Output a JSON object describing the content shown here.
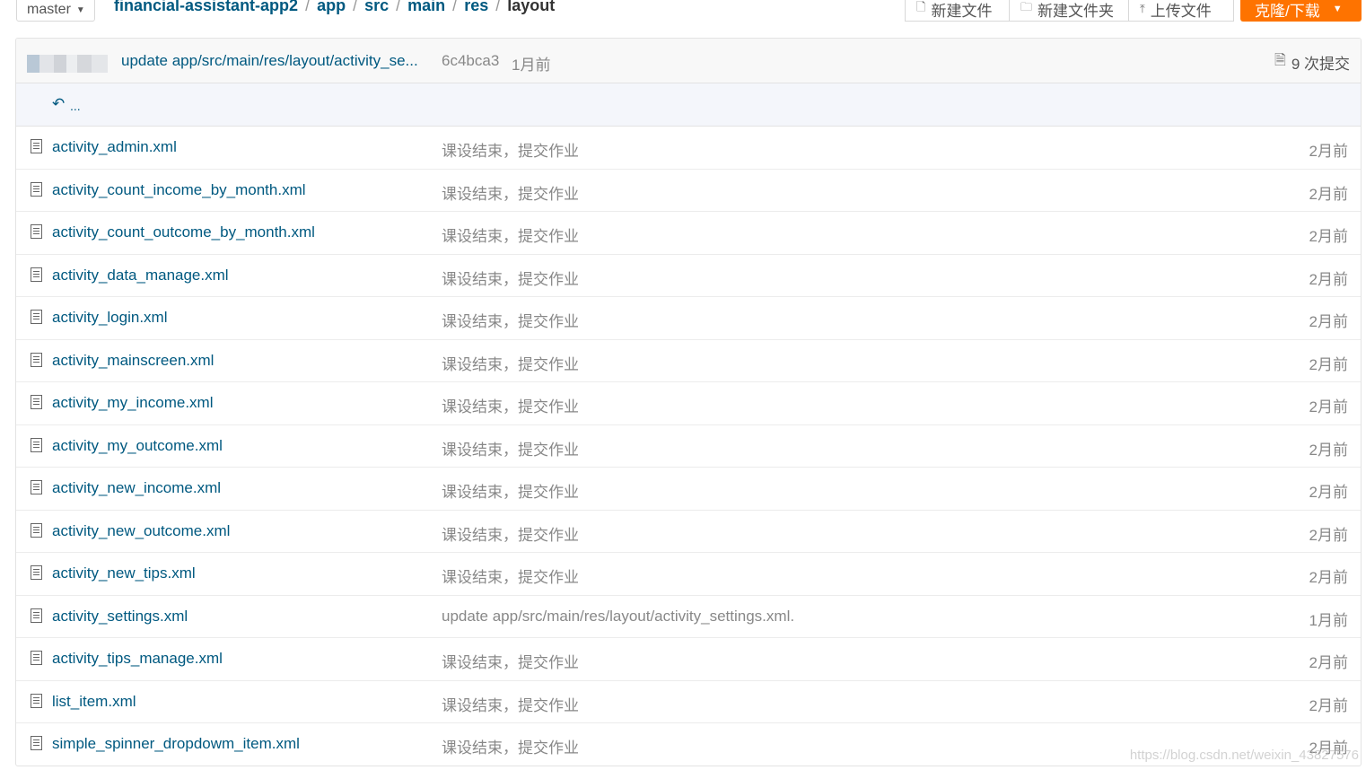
{
  "branch": "master",
  "breadcrumb": [
    "financial-assistant-app2",
    "app",
    "src",
    "main",
    "res"
  ],
  "breadcrumb_current": "layout",
  "actions": {
    "new_file": "新建文件",
    "new_folder": "新建文件夹",
    "upload": "上传文件",
    "clone": "克隆/下载"
  },
  "latest_commit": {
    "message": "update app/src/main/res/layout/activity_se...",
    "hash": "6c4bca3",
    "time": "1月前",
    "count": "9 次提交"
  },
  "parent_dir": "...",
  "files": [
    {
      "name": "activity_admin.xml",
      "message": "课设结束，提交作业",
      "time": "2月前"
    },
    {
      "name": "activity_count_income_by_month.xml",
      "message": "课设结束，提交作业",
      "time": "2月前"
    },
    {
      "name": "activity_count_outcome_by_month.xml",
      "message": "课设结束，提交作业",
      "time": "2月前"
    },
    {
      "name": "activity_data_manage.xml",
      "message": "课设结束，提交作业",
      "time": "2月前"
    },
    {
      "name": "activity_login.xml",
      "message": "课设结束，提交作业",
      "time": "2月前"
    },
    {
      "name": "activity_mainscreen.xml",
      "message": "课设结束，提交作业",
      "time": "2月前"
    },
    {
      "name": "activity_my_income.xml",
      "message": "课设结束，提交作业",
      "time": "2月前"
    },
    {
      "name": "activity_my_outcome.xml",
      "message": "课设结束，提交作业",
      "time": "2月前"
    },
    {
      "name": "activity_new_income.xml",
      "message": "课设结束，提交作业",
      "time": "2月前"
    },
    {
      "name": "activity_new_outcome.xml",
      "message": "课设结束，提交作业",
      "time": "2月前"
    },
    {
      "name": "activity_new_tips.xml",
      "message": "课设结束，提交作业",
      "time": "2月前"
    },
    {
      "name": "activity_settings.xml",
      "message": "update app/src/main/res/layout/activity_settings.xml.",
      "time": "1月前"
    },
    {
      "name": "activity_tips_manage.xml",
      "message": "课设结束，提交作业",
      "time": "2月前"
    },
    {
      "name": "list_item.xml",
      "message": "课设结束，提交作业",
      "time": "2月前"
    },
    {
      "name": "simple_spinner_dropdowm_item.xml",
      "message": "课设结束，提交作业",
      "time": "2月前"
    }
  ],
  "watermark": "https://blog.csdn.net/weixin_43827576",
  "colors": {
    "link": "#005980",
    "accent": "#fe7300",
    "muted": "#888888"
  }
}
